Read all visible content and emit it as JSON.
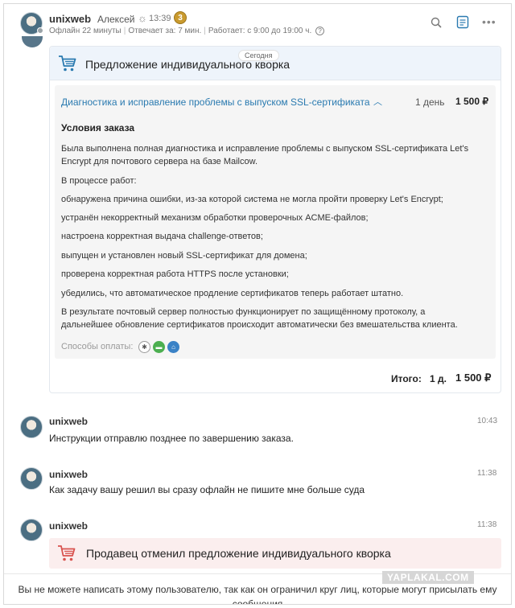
{
  "header": {
    "username": "unixweb",
    "person_name": "Алексей",
    "local_time": "13:39",
    "level_badge": "3",
    "status": "Офлайн 22 минуты",
    "response": "Отвечает за: 7 мин.",
    "work_hours": "Работает: с 9:00 до 19:00 ч.",
    "help_icon_text": "?"
  },
  "offer": {
    "title": "Предложение индивидуального кворка",
    "date_badge": "Сегодня",
    "gig_title": "Диагностика и исправление проблемы с выпуском SSL-сертификата",
    "gig_days": "1 день",
    "gig_price": "1 500 ₽",
    "conditions_title": "Условия заказа",
    "lines": [
      "Была выполнена полная диагностика и исправление проблемы с выпуском SSL-сертификата Let's",
      "Encrypt для почтового сервера на базе Mailcow.",
      "В процессе работ:",
      "обнаружена причина ошибки, из-за которой система не могла пройти проверку Let's Encrypt;",
      "устранён некорректный механизм обработки проверочных ACME-файлов;",
      "настроена корректная выдача challenge-ответов;",
      "выпущен и установлен новый SSL-сертификат для домена;",
      "проверена корректная работа HTTPS после установки;",
      "убедились, что автоматическое продление сертификатов теперь работает штатно.",
      "В результате почтовый сервер полностью функционирует по защищённому протоколу, а",
      "дальнейшее обновление сертификатов происходит автоматически без вмешательства клиента."
    ],
    "payment_label": "Способы оплаты:",
    "total_label": "Итого:",
    "total_days": "1 д.",
    "total_price": "1 500 ₽"
  },
  "messages": [
    {
      "author": "unixweb",
      "time": "10:43",
      "text": "Инструкции отправлю позднее по завершению заказа."
    },
    {
      "author": "unixweb",
      "time": "11:38",
      "text": "Как задачу вашу решил вы сразу офлайн не пишите мне больше суда"
    },
    {
      "author": "unixweb",
      "time": "11:38",
      "text": ""
    }
  ],
  "cancel_notice": "Продавец отменил предложение индивидуального кворка",
  "footer_text": "Вы не можете написать этому пользователю, так как он ограничил круг лиц, которые могут присылать ему сообщения",
  "watermark": "YAPLAKAL.COM",
  "colors": {
    "link": "#2a7ab0",
    "cart_blue": "#2a7ab0",
    "cart_red": "#d9534f",
    "offer_head_bg": "#eef4fb",
    "cancel_bg": "#fbeeee"
  }
}
